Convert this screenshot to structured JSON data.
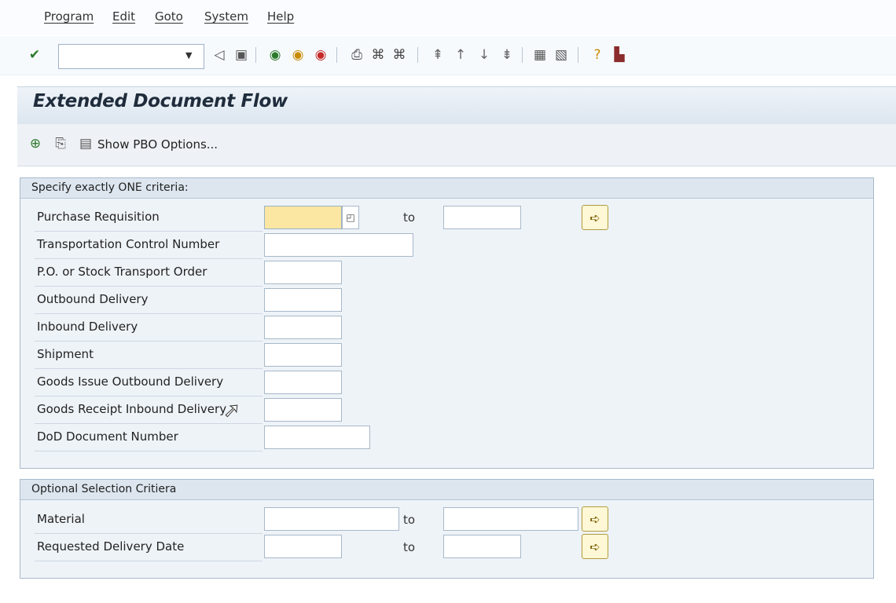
{
  "menu": [
    "Program",
    "Edit",
    "Goto",
    "System",
    "Help"
  ],
  "toolbar": {
    "command_field_value": "",
    "icons": [
      "enter-icon",
      "back-icon",
      "save-icon",
      "exit-icon",
      "cancel-icon",
      "print-icon",
      "find-icon",
      "find-next-icon",
      "first-page-icon",
      "prev-page-icon",
      "next-page-icon",
      "last-page-icon",
      "new-session-icon",
      "shortcut-icon",
      "help-icon",
      "layout-icon"
    ]
  },
  "title": "Extended Document Flow",
  "app_toolbar": {
    "execute_icon": "execute-icon",
    "variant_icon": "get-variant-icon",
    "pbo_label": "Show PBO Options..."
  },
  "required_criteria": {
    "heading": "Specify exactly ONE criteria:",
    "fields": [
      {
        "label": "Purchase Requisition",
        "value": "",
        "to_value": ""
      },
      {
        "label": "Transportation Control Number",
        "value": ""
      },
      {
        "label": "P.O. or Stock Transport Order",
        "value": ""
      },
      {
        "label": "Outbound Delivery",
        "value": ""
      },
      {
        "label": "Inbound Delivery",
        "value": ""
      },
      {
        "label": "Shipment",
        "value": ""
      },
      {
        "label": "Goods Issue Outbound Delivery",
        "value": ""
      },
      {
        "label": "Goods Receipt Inbound Delivery",
        "value": ""
      },
      {
        "label": "DoD Document Number",
        "value": ""
      }
    ]
  },
  "optional_criteria": {
    "heading": "Optional Selection Critiera",
    "fields": [
      {
        "label": "Material",
        "value": "",
        "to_value": ""
      },
      {
        "label": "Requested Delivery Date",
        "value": "",
        "to_value": ""
      }
    ]
  },
  "to_label": "to",
  "colors": {
    "accent_field": "#fbe7a2",
    "group_bg": "#eef3f8",
    "title_bg": "#dce6f0"
  }
}
